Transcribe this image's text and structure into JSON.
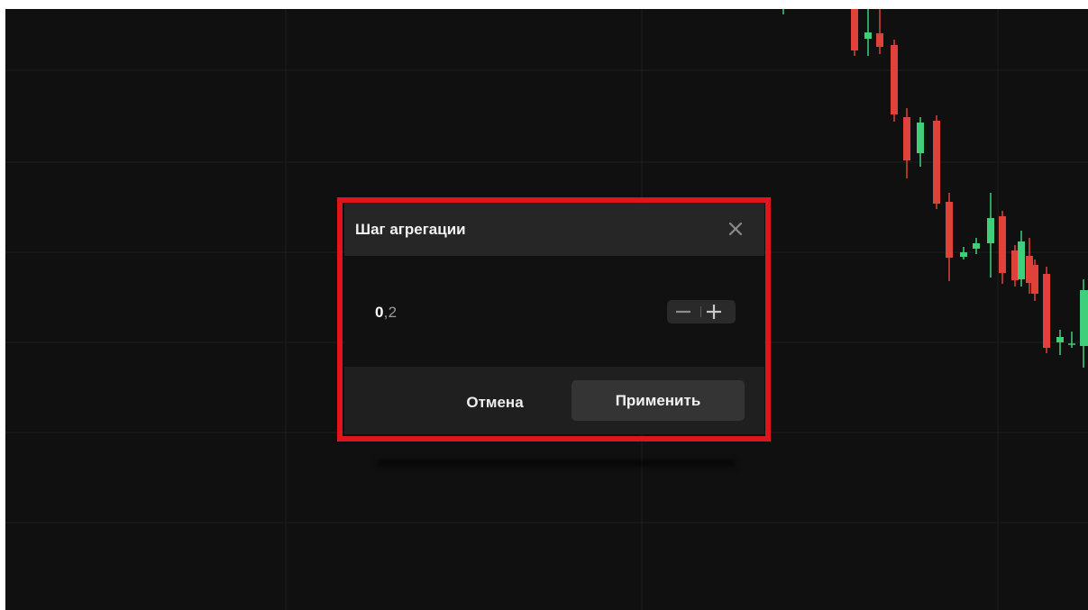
{
  "dialog": {
    "title": "Шаг агрегации",
    "value_integer": "0",
    "value_fraction": ",2",
    "cancel_label": "Отмена",
    "apply_label": "Применить"
  },
  "icons": {
    "close": "close-icon",
    "minus": "minus-icon",
    "plus": "plus-icon"
  },
  "colors": {
    "background": "#101010",
    "highlight": "#e0151b",
    "bearish": "#e0413a",
    "bullish": "#3fcf7b"
  }
}
